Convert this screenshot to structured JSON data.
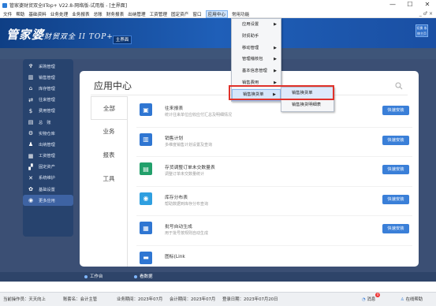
{
  "window": {
    "title": "管家婆财贸双全IITop+ V22.8-网络版-试用版 - [主界面]",
    "controls": [
      "—",
      "☐",
      "✕"
    ]
  },
  "menubar": {
    "items": [
      "文件",
      "帮助",
      "基础资料",
      "业务处理",
      "业务报表",
      "总账",
      "财务报表",
      "出纳管理",
      "工资管理",
      "固定资产",
      "窗口",
      "应用中心",
      "常用功能"
    ],
    "active_index": 11,
    "right_controls": "_ ♂ ×"
  },
  "header": {
    "logo_main": "管家婆",
    "logo_sub": "财贸双全 II TOP+",
    "home_tab": "主界面",
    "right_button": "切换 系统主页"
  },
  "sidebar": {
    "items": [
      {
        "icon": "tree-icon",
        "glyph": "♆",
        "label": "采购管理"
      },
      {
        "icon": "chart-icon",
        "glyph": "▥",
        "label": "销售管理"
      },
      {
        "icon": "home-icon",
        "glyph": "⌂",
        "label": "库存管理"
      },
      {
        "icon": "exchange-icon",
        "glyph": "⇄",
        "label": "往来管理"
      },
      {
        "icon": "dollar-icon",
        "glyph": "$",
        "label": "费用管理"
      },
      {
        "icon": "ledger-icon",
        "glyph": "▤",
        "label": "总　账"
      },
      {
        "icon": "settings-icon",
        "glyph": "⚙",
        "label": "实物仓库"
      },
      {
        "icon": "user-icon",
        "glyph": "♟",
        "label": "出纳管理"
      },
      {
        "icon": "table-icon",
        "glyph": "▦",
        "label": "工资管理"
      },
      {
        "icon": "grid-icon",
        "glyph": "▞",
        "label": "固定资产"
      },
      {
        "icon": "tools-icon",
        "glyph": "✕",
        "label": "系统维护"
      },
      {
        "icon": "gear-icon",
        "glyph": "✿",
        "label": "基础设置"
      },
      {
        "icon": "apps-icon",
        "glyph": "◉",
        "label": "更多应用"
      }
    ],
    "active_index": 12
  },
  "panel": {
    "title": "应用中心",
    "tabs": [
      "全部",
      "业务",
      "报表",
      "工具"
    ],
    "active_tab": 0,
    "apps": [
      {
        "icon": "report-icon",
        "glyph": "▣",
        "color": "#2f76d2",
        "name": "往来报表",
        "desc": "统计往来单位应收应付汇总及明细情况",
        "button": "快速安装"
      },
      {
        "icon": "bar-chart-icon",
        "glyph": "▥",
        "color": "#2f76d2",
        "name": "销售计划",
        "desc": "多维度销售计划设置及查询",
        "button": "快速安装"
      },
      {
        "icon": "document-icon",
        "glyph": "▤",
        "color": "#22a06b",
        "name": "存货调整订单未交数量表",
        "desc": "调整订单未交数量统计",
        "button": "快速安装"
      },
      {
        "icon": "location-icon",
        "glyph": "◉",
        "color": "#2f9fe0",
        "name": "库存分布表",
        "desc": "帮助数据到库存分布查询",
        "button": "快速安装"
      },
      {
        "icon": "print-icon",
        "glyph": "▦",
        "color": "#2f76d2",
        "name": "批号自动生成",
        "desc": "用于批号按规则自动生成",
        "button": "快速安装"
      },
      {
        "icon": "link-icon",
        "glyph": "▬",
        "color": "#2f76d2",
        "name": "图标(Link",
        "desc": "",
        "button": ""
      }
    ]
  },
  "dropdown": {
    "items": [
      {
        "label": "应用设置",
        "arrow": true
      },
      {
        "label": "财贸助手",
        "arrow": false
      },
      {
        "label": "移动管理",
        "arrow": true
      },
      {
        "label": "管理稽核包",
        "arrow": true
      },
      {
        "label": "基本信息管理",
        "arrow": true
      },
      {
        "label": "销售费用",
        "arrow": true
      },
      {
        "label": "销售换货单",
        "arrow": true
      }
    ],
    "submenu": [
      "销售换货单",
      "销售换货明细表"
    ]
  },
  "bottom_nav": {
    "items": [
      "工作台",
      "看数据"
    ]
  },
  "statusbar": {
    "operator": "当前操作员：天天向上",
    "company": "账套名：会计主管",
    "business_date": "业务期间：2023年07月",
    "account_date": "会计期间：2023年07月",
    "login_date": "登录日期：2023年07月20日",
    "messages_label": "消息",
    "messages_count": "0",
    "help_label": "在线帮助"
  }
}
